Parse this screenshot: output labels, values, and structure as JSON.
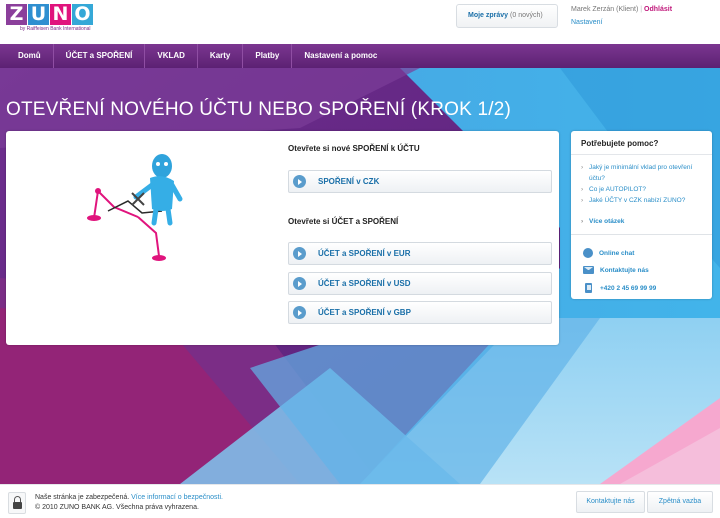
{
  "brand": {
    "letters": [
      "Z",
      "U",
      "N",
      "O"
    ],
    "letter_colors": [
      "#8b3f9b",
      "#2f8fd0",
      "#e0147d",
      "#35a8d7"
    ],
    "tagline": "by Raiffeisen Bank International"
  },
  "header": {
    "messages_label": "Moje zprávy",
    "messages_count": "(0 nových)",
    "user_name": "Marek Zerzán (Klient)",
    "separator": "|",
    "logout": "Odhlásit",
    "settings": "Nastavení"
  },
  "nav": {
    "items": [
      {
        "label": "Domů",
        "icon": "home"
      },
      {
        "label": "ÚČET a SPOŘENÍ"
      },
      {
        "label": "VKLAD"
      },
      {
        "label": "Karty"
      },
      {
        "label": "Platby"
      },
      {
        "label": "Nastavení a pomoc"
      }
    ]
  },
  "page": {
    "title": "OTEVŘENÍ NOVÉHO ÚČTU NEBO SPOŘENÍ (KROK 1/2)"
  },
  "panel": {
    "section1_title": "Otevřete si nové SPOŘENÍ k ÚČTU",
    "section1_options": [
      "SPOŘENÍ v CZK"
    ],
    "section2_title": "Otevřete si ÚČET a SPOŘENÍ",
    "section2_options": [
      "ÚČET a SPOŘENÍ v EUR",
      "ÚČET a SPOŘENÍ v USD",
      "ÚČET a SPOŘENÍ v GBP"
    ]
  },
  "help": {
    "title": "Potřebujete pomoc?",
    "questions": [
      "Jaký je minimální vklad pro otevření účtu?",
      "Co je AUTOPILOT?",
      "Jaké ÚČTY v CZK nabízí ZUNO?"
    ],
    "more": "Více otázek",
    "chat": "Online chat",
    "contact": "Kontaktujte nás",
    "phone": "+420 2 45 69 99 99"
  },
  "footer": {
    "secure_text": "Naše stránka je zabezpečená.",
    "security_link": "Více informací o bezpečnosti.",
    "copyright": "© 2010 ZUNO BANK AG. Všechna práva vyhrazena.",
    "contact_btn": "Kontaktujte nás",
    "feedback_btn": "Zpětná vazba"
  }
}
